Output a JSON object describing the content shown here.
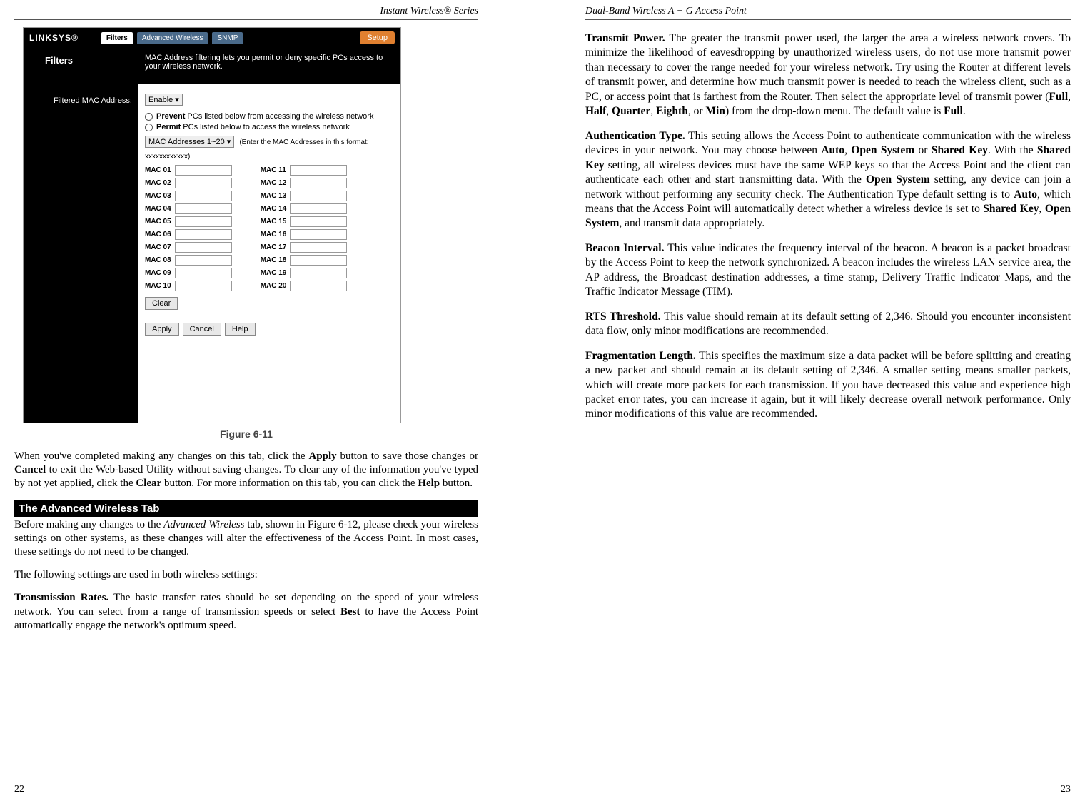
{
  "left": {
    "header": "Instant Wireless® Series",
    "pageNumber": "22",
    "figureCaption": "Figure 6-11",
    "screenshot": {
      "logo": "LINKSYS®",
      "tabs": {
        "filters": "Filters",
        "advanced": "Advanced Wireless",
        "snmp": "SNMP"
      },
      "setup": "Setup",
      "sidebarTitle": "Filters",
      "desc": "MAC Address filtering lets you permit or deny specific PCs access to your wireless network.",
      "filterLabel": "Filtered MAC Address:",
      "enableSelect": "Enable ▾",
      "prevent": "Prevent",
      "preventSuffix": " PCs listed below from accessing the wireless network",
      "permit": "Permit",
      "permitSuffix": " PCs listed below to access the wireless network",
      "rangeSelect": "MAC Addresses 1~20 ▾",
      "enterHint": "(Enter the MAC Addresses in this format: xxxxxxxxxxxx)",
      "macLeft": [
        "MAC 01",
        "MAC 02",
        "MAC 03",
        "MAC 04",
        "MAC 05",
        "MAC 06",
        "MAC 07",
        "MAC 08",
        "MAC 09",
        "MAC 10"
      ],
      "macRight": [
        "MAC 11",
        "MAC 12",
        "MAC 13",
        "MAC 14",
        "MAC 15",
        "MAC 16",
        "MAC 17",
        "MAC 18",
        "MAC 19",
        "MAC 20"
      ],
      "clear": "Clear",
      "apply": "Apply",
      "cancel": "Cancel",
      "help": "Help"
    },
    "para1": {
      "t1": "When you've completed making any changes on this tab, click the ",
      "b1": "Apply",
      "t2": " button to save those changes or ",
      "b2": "Cancel",
      "t3": " to exit the Web-based Utility without saving changes. To clear any of the information you've typed by not yet applied, click the ",
      "b3": "Clear",
      "t4": " button. For more information on this tab, you can click the ",
      "b4": "Help",
      "t5": " button."
    },
    "sectionHeader": "The Advanced Wireless Tab",
    "para2": {
      "t1": "Before making any changes to the ",
      "i1": "Advanced Wireless",
      "t2": " tab, shown in Figure 6-12, please check your wireless settings on other systems, as these changes will alter the effectiveness of the Access Point. In most cases, these settings do not need to be changed."
    },
    "para3": "The following settings are used in both wireless settings:",
    "para4": {
      "b1": "Transmission Rates.",
      "t1": " The basic transfer rates should be set depending on the speed of your wireless network. You can select from a range of transmission speeds or select ",
      "b2": "Best",
      "t2": " to have the Access Point automatically engage the network's optimum speed."
    }
  },
  "right": {
    "header": "Dual-Band Wireless A + G Access Point",
    "pageNumber": "23",
    "para1": {
      "b1": "Transmit Power.",
      "t1": "  The greater the transmit power used, the larger the area a wireless network covers. To minimize the likelihood of eavesdropping by unauthorized wireless users, do not use more transmit power than necessary to cover the range needed for your wireless network. Try using the Router at different levels of transmit power, and determine how much transmit power is needed to reach the wireless client, such as a PC, or access point that is farthest from the Router. Then select the appropriate level of transmit power (",
      "b2": "Full",
      "t2": ", ",
      "b3": "Half",
      "t3": ", ",
      "b4": "Quarter",
      "t4": ", ",
      "b5": "Eighth",
      "t5": ", or ",
      "b6": "Min",
      "t6": ") from the drop-down menu. The default value is ",
      "b7": "Full",
      "t7": "."
    },
    "para2": {
      "b1": "Authentication Type.",
      "t1": " This setting allows the Access Point to authenticate communication with the wireless devices in your network. You may choose between ",
      "b2": "Auto",
      "t2": ", ",
      "b3": "Open System",
      "t3": " or ",
      "b4": "Shared Key",
      "t4": ".  With the ",
      "b5": "Shared Key",
      "t5": " setting, all wireless devices must have the same WEP keys so that the Access Point and the client can authenticate each other and start transmitting data. With the ",
      "b6": "Open System",
      "t6": " setting, any device can join a network without performing any security check. The Authentication Type default setting is to ",
      "b7": "Auto",
      "t7": ", which means that the Access Point will automatically detect whether a wireless device is set to ",
      "b8": "Shared Key",
      "t8": ", ",
      "b9": "Open System",
      "t9": ", and transmit data appropriately."
    },
    "para3": {
      "b1": "Beacon Interval.",
      "t1": "  This value indicates the frequency interval of the beacon. A beacon is a packet broadcast by the Access Point to keep the network synchronized. A beacon includes the wireless LAN service area, the AP address, the Broadcast destination addresses, a time stamp, Delivery Traffic Indicator Maps, and the Traffic Indicator Message (TIM)."
    },
    "para4": {
      "b1": "RTS Threshold.",
      "t1": "  This value should remain at its default setting of 2,346. Should you encounter inconsistent data flow, only minor modifications are recommended."
    },
    "para5": {
      "b1": "Fragmentation Length.",
      "t1": "  This specifies the maximum size a data packet will be before splitting and creating a new packet and should remain at its default setting of 2,346. A smaller setting means smaller packets, which will create more packets for each transmission. If you have decreased this value and experience high packet error rates, you can increase it again, but it will likely decrease overall network performance. Only minor modifications of this value are recommended."
    }
  }
}
